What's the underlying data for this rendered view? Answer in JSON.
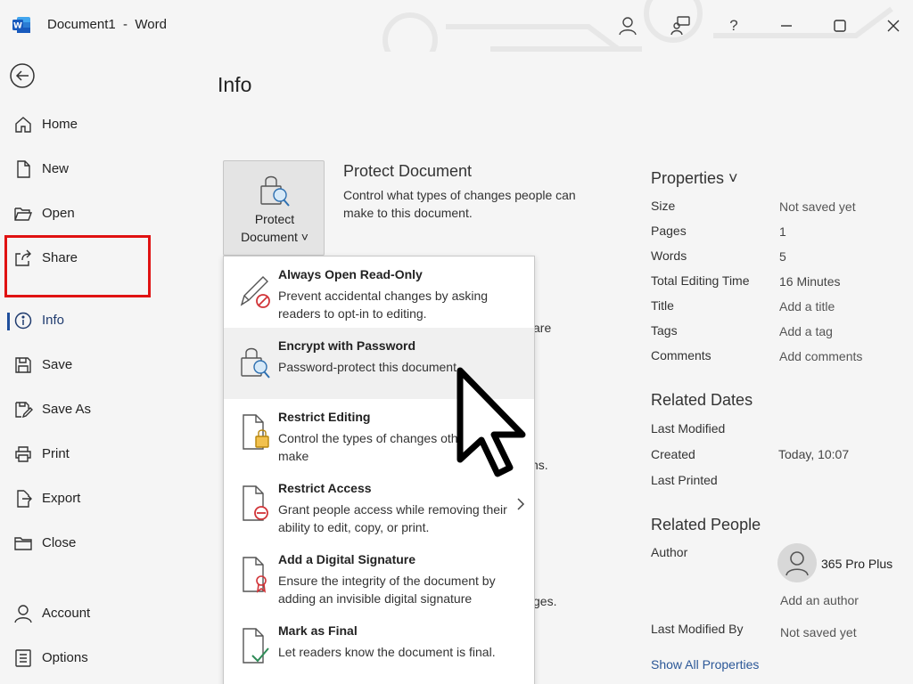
{
  "window": {
    "title": "Document1  -  Word"
  },
  "sidebar": {
    "items": [
      {
        "label": "Home",
        "icon": "home-icon"
      },
      {
        "label": "New",
        "icon": "new-document-icon"
      },
      {
        "label": "Open",
        "icon": "folder-open-icon"
      },
      {
        "label": "Share",
        "icon": "share-icon"
      },
      {
        "label": "Info",
        "icon": "info-icon"
      },
      {
        "label": "Save",
        "icon": "save-icon"
      },
      {
        "label": "Save As",
        "icon": "save-as-icon"
      },
      {
        "label": "Print",
        "icon": "print-icon"
      },
      {
        "label": "Export",
        "icon": "export-icon"
      },
      {
        "label": "Close",
        "icon": "close-folder-icon"
      },
      {
        "label": "Account",
        "icon": "account-icon"
      },
      {
        "label": "Options",
        "icon": "options-icon"
      }
    ]
  },
  "main": {
    "title": "Info",
    "protect": {
      "button_line1": "Protect",
      "button_line2": "Document ˅",
      "title": "Protect Document",
      "desc": "Control what types of changes people can make to this document."
    },
    "peek": [
      "are",
      "ns.",
      "ges."
    ]
  },
  "menu": {
    "items": [
      {
        "title": "Always Open Read-Only",
        "desc": "Prevent accidental changes by asking readers to opt-in to editing."
      },
      {
        "title": "Encrypt with Password",
        "desc": "Password-protect this document"
      },
      {
        "title": "Restrict Editing",
        "desc": "Control the types of changes others can make"
      },
      {
        "title": "Restrict Access",
        "desc": "Grant people access while removing their ability to edit, copy, or print."
      },
      {
        "title": "Add a Digital Signature",
        "desc": "Ensure the integrity of the document by adding an invisible digital signature"
      },
      {
        "title": "Mark as Final",
        "desc": "Let readers know the document is final."
      }
    ]
  },
  "properties": {
    "header": "Properties ˅",
    "rows": [
      {
        "key": "Size",
        "value": "Not saved yet"
      },
      {
        "key": "Pages",
        "value": "1"
      },
      {
        "key": "Words",
        "value": "5"
      },
      {
        "key": "Total Editing Time",
        "value": "16 Minutes"
      },
      {
        "key": "Title",
        "value": "Add a title"
      },
      {
        "key": "Tags",
        "value": "Add a tag"
      },
      {
        "key": "Comments",
        "value": "Add comments"
      }
    ],
    "dates_header": "Related Dates",
    "dates": [
      {
        "key": "Last Modified",
        "value": ""
      },
      {
        "key": "Created",
        "value": "Today, 10:07"
      },
      {
        "key": "Last Printed",
        "value": ""
      }
    ],
    "people_header": "Related People",
    "author_key": "Author",
    "author_name": "365 Pro Plus",
    "add_author": "Add an author",
    "last_modified_by_key": "Last Modified By",
    "last_modified_by_value": "Not saved yet",
    "show_all": "Show All Properties"
  },
  "colors": {
    "highlight": "#e01212",
    "word_blue": "#185abd",
    "link": "#2b5797"
  }
}
